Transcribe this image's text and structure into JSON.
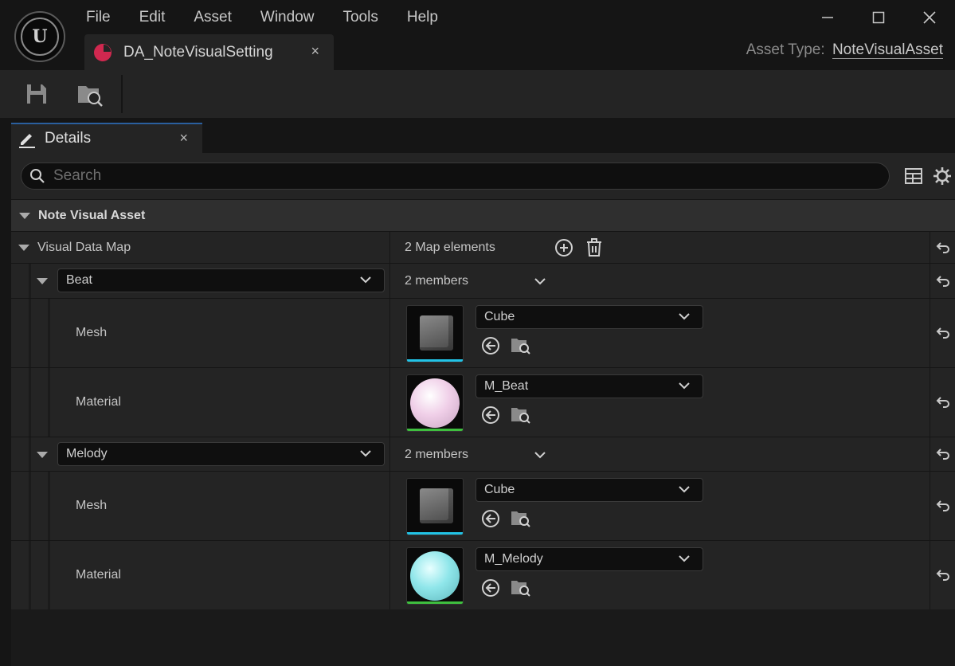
{
  "menu": [
    "File",
    "Edit",
    "Asset",
    "Window",
    "Tools",
    "Help"
  ],
  "document_tab": {
    "label": "DA_NoteVisualSetting",
    "close": "×"
  },
  "asset_type": {
    "label": "Asset Type:",
    "value": "NoteVisualAsset"
  },
  "details_tab": {
    "label": "Details",
    "close": "×"
  },
  "search": {
    "placeholder": "Search"
  },
  "category": {
    "label": "Note Visual Asset"
  },
  "map": {
    "label": "Visual Data Map",
    "summary": "2 Map elements",
    "entries": [
      {
        "key": "Beat",
        "members": "2 members",
        "mesh": {
          "label": "Mesh",
          "value": "Cube",
          "bar_color": "#22c3e6"
        },
        "material": {
          "label": "Material",
          "value": "M_Beat",
          "bar_color": "#3fbf3f",
          "preview_color": "#f0cfe8"
        }
      },
      {
        "key": "Melody",
        "members": "2 members",
        "mesh": {
          "label": "Mesh",
          "value": "Cube",
          "bar_color": "#22c3e6"
        },
        "material": {
          "label": "Material",
          "value": "M_Melody",
          "bar_color": "#3fbf3f",
          "preview_color": "#8fe6ea"
        }
      }
    ]
  },
  "colors": {
    "accent_tab": "#2a5f9e",
    "asset_icon": "#d0284f"
  }
}
